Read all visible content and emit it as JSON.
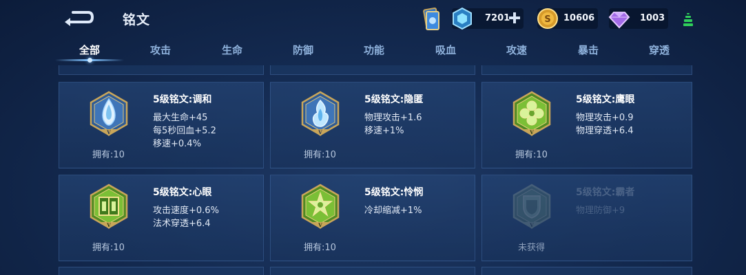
{
  "header": {
    "title": "铭文",
    "back_icon": "back-arrow-icon"
  },
  "currencies": {
    "gem": {
      "value": "7201",
      "icon": "blue-crystal-icon"
    },
    "gold": {
      "value": "10606",
      "icon": "gold-coin-icon"
    },
    "diamond": {
      "value": "1003",
      "icon": "purple-diamond-icon"
    }
  },
  "tabs": [
    {
      "label": "全部",
      "active": true
    },
    {
      "label": "攻击"
    },
    {
      "label": "生命"
    },
    {
      "label": "防御"
    },
    {
      "label": "功能"
    },
    {
      "label": "吸血"
    },
    {
      "label": "攻速"
    },
    {
      "label": "暴击"
    },
    {
      "label": "穿透"
    }
  ],
  "runes": [
    {
      "name": "5级铭文:调和",
      "stats": [
        "最大生命+45",
        "每5秒回血+5.2",
        "移速+0.4%"
      ],
      "owned": "拥有:10",
      "color": "blue",
      "icon": "teardrop-rune-icon",
      "locked": false
    },
    {
      "name": "5级铭文:隐匿",
      "stats": [
        "物理攻击+1.6",
        "移速+1%"
      ],
      "owned": "拥有:10",
      "color": "blue",
      "icon": "flame-rune-icon",
      "locked": false
    },
    {
      "name": "5级铭文:鹰眼",
      "stats": [
        "物理攻击+0.9",
        "物理穿透+6.4"
      ],
      "owned": "拥有:10",
      "color": "green",
      "icon": "clover-rune-icon",
      "locked": false
    },
    {
      "name": "5级铭文:心眼",
      "stats": [
        "攻击速度+0.6%",
        "法术穿透+6.4"
      ],
      "owned": "拥有:10",
      "color": "green",
      "icon": "gate-rune-icon",
      "locked": false
    },
    {
      "name": "5级铭文:怜悯",
      "stats": [
        "冷却缩减+1%"
      ],
      "owned": "拥有:10",
      "color": "green",
      "icon": "star-rune-icon",
      "locked": false
    },
    {
      "name": "5级铭文:霸者",
      "stats": [
        "物理防御+9"
      ],
      "owned": "未获得",
      "color": "green",
      "icon": "shield-rune-icon",
      "locked": true
    }
  ],
  "colors": {
    "accent": "#7fc2ff",
    "blue_rune": "#4a7ec4",
    "green_rune": "#6aa52e",
    "gold_frame": "#c9a65a"
  }
}
